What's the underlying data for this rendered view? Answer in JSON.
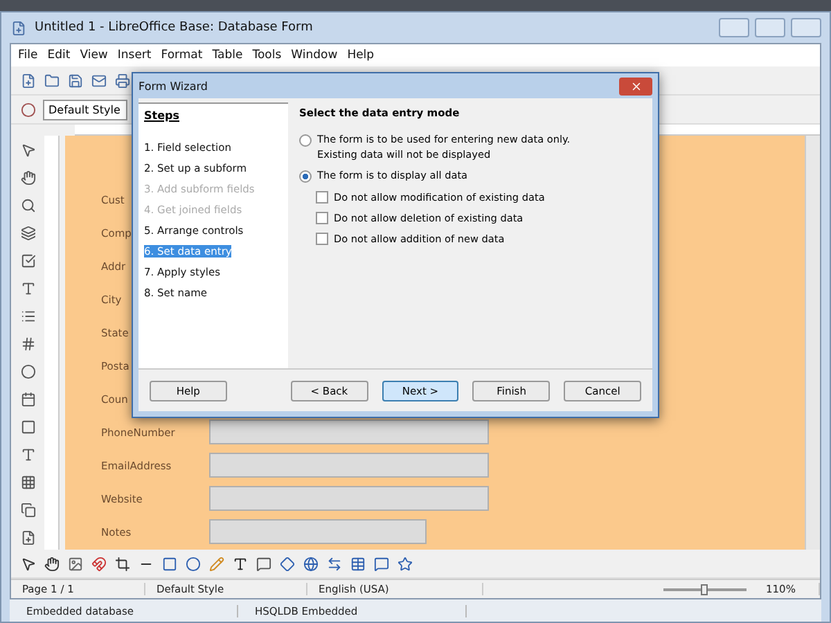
{
  "window": {
    "title": "Untitled 1 - LibreOffice Base: Database Form"
  },
  "menu": [
    "File",
    "Edit",
    "View",
    "Insert",
    "Format",
    "Table",
    "Tools",
    "Window",
    "Help"
  ],
  "style_box": {
    "value": "Default Style"
  },
  "form_fields": [
    {
      "label": "Cust",
      "kind": "label"
    },
    {
      "label": "Comp",
      "kind": "label"
    },
    {
      "label": "Addr",
      "kind": "label"
    },
    {
      "label": "City",
      "kind": "label"
    },
    {
      "label": "State",
      "kind": "label"
    },
    {
      "label": "Posta",
      "kind": "label"
    },
    {
      "label": "Coun",
      "kind": "label"
    },
    {
      "label": "PhoneNumber",
      "kind": "wide"
    },
    {
      "label": "EmailAddress",
      "kind": "wide"
    },
    {
      "label": "Website",
      "kind": "wide"
    },
    {
      "label": "Notes",
      "kind": "short"
    }
  ],
  "dialog": {
    "title": "Form Wizard",
    "steps_heading": "Steps",
    "steps": [
      {
        "label": "1. Field selection",
        "disabled": false,
        "selected": false
      },
      {
        "label": "2. Set up a subform",
        "disabled": false,
        "selected": false
      },
      {
        "label": "3. Add subform fields",
        "disabled": true,
        "selected": false
      },
      {
        "label": "4. Get joined fields",
        "disabled": true,
        "selected": false
      },
      {
        "label": "5. Arrange controls",
        "disabled": false,
        "selected": false
      },
      {
        "label": "6. Set data entry",
        "disabled": false,
        "selected": true
      },
      {
        "label": "7. Apply styles",
        "disabled": false,
        "selected": false
      },
      {
        "label": "8. Set name",
        "disabled": false,
        "selected": false
      }
    ],
    "heading": "Select the data entry mode",
    "modes": [
      {
        "label": "The form is to be used for entering new data only.",
        "note": "Existing data will not be displayed",
        "selected": false
      },
      {
        "label": "The form is to display all data",
        "selected": true,
        "options": [
          {
            "label": "Do not allow modification of existing data",
            "checked": false
          },
          {
            "label": "Do not allow deletion of existing data",
            "checked": false
          },
          {
            "label": "Do not allow addition of new data",
            "checked": false
          }
        ]
      }
    ],
    "buttons": [
      {
        "label": "Help",
        "focused": false
      },
      {
        "label": "< Back",
        "focused": false
      },
      {
        "label": "Next >",
        "focused": true
      },
      {
        "label": "Finish",
        "focused": false
      },
      {
        "label": "Cancel",
        "focused": false
      }
    ]
  },
  "status_bar": {
    "page": "Page 1 / 1",
    "style": "Default Style",
    "language": "English (USA)",
    "zoom": {
      "level": 0.5
    },
    "zoom_text": "110%"
  },
  "outer_status": [
    "Embedded database",
    "HSQLDB Embedded"
  ]
}
